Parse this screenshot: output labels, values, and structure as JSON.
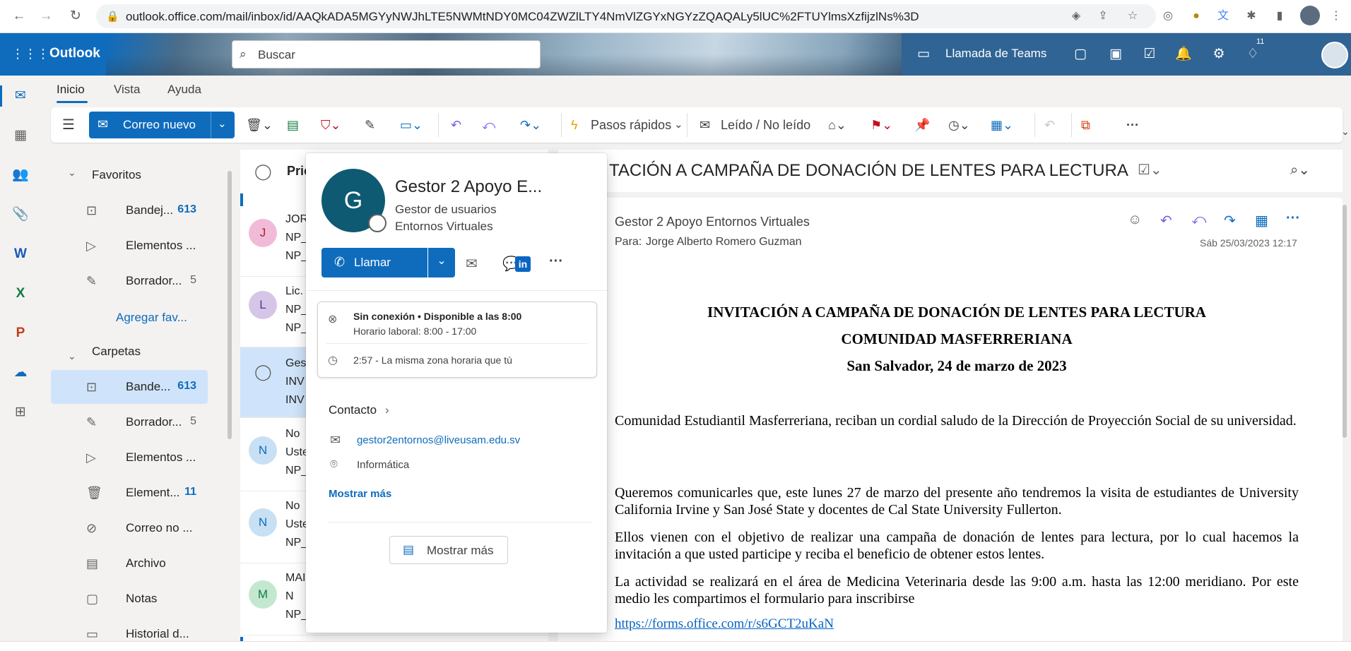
{
  "browser": {
    "url": "outlook.office.com/mail/inbox/id/AAQkADA5MGYyNWJhLTE5NWMtNDY0MC04ZWZlLTY4NmVlZGYxNGYzZQAQALy5lUC%2FTUYlmsXzfijzlNs%3D"
  },
  "header": {
    "app_name": "Outlook",
    "search_placeholder": "Buscar",
    "teams_call": "Llamada de Teams",
    "notifications_badge": "11"
  },
  "tabs": [
    "Inicio",
    "Vista",
    "Ayuda"
  ],
  "ribbon": {
    "new_mail": "Correo nuevo",
    "quick_steps": "Pasos rápidos",
    "read_unread": "Leído / No leído"
  },
  "folders": {
    "favorites_title": "Favoritos",
    "favorites": [
      {
        "label": "Bandej...",
        "count": "613"
      },
      {
        "label": "Elementos ...",
        "count": ""
      },
      {
        "label": "Borrador...",
        "count": "5"
      }
    ],
    "add_favorite": "Agregar fav...",
    "folders_title": "Carpetas",
    "items": [
      {
        "label": "Bande...",
        "count": "613"
      },
      {
        "label": "Borrador...",
        "count": "5"
      },
      {
        "label": "Elementos ...",
        "count": ""
      },
      {
        "label": "Element...",
        "count": "11"
      },
      {
        "label": "Correo no ...",
        "count": ""
      },
      {
        "label": "Archivo",
        "count": ""
      },
      {
        "label": "Notas",
        "count": ""
      },
      {
        "label": "Historial d...",
        "count": ""
      }
    ]
  },
  "message_list": {
    "tab_label": "Pric",
    "messages": [
      {
        "initial": "J",
        "lines": [
          "JOR",
          "NP_",
          "NP_"
        ]
      },
      {
        "initial": "L",
        "lines": [
          "Lic.",
          "NP_",
          "NP_"
        ]
      },
      {
        "initial": "",
        "lines": [
          "Ges",
          "INV",
          "INV"
        ]
      },
      {
        "initial": "N",
        "lines": [
          "No",
          "Uste",
          "NP_"
        ]
      },
      {
        "initial": "N",
        "lines": [
          "No",
          "Uste",
          "NP_"
        ]
      },
      {
        "initial": "M",
        "lines": [
          "MAI",
          "N",
          "NP_"
        ]
      }
    ]
  },
  "email": {
    "subject_visible": "TACIÓN A CAMPAÑA DE DONACIÓN DE LENTES PARA LECTURA",
    "sender": "Gestor 2 Apoyo Entornos Virtuales",
    "to_label": "Para:",
    "to_name": "Jorge Alberto Romero Guzman",
    "date": "Sáb 25/03/2023 12:17",
    "body_title_1": "INVITACIÓN A CAMPAÑA DE DONACIÓN DE LENTES PARA LECTURA",
    "body_title_2": "COMUNIDAD MASFERRERIANA",
    "body_title_3": "San Salvador, 24 de marzo de 2023",
    "p1": "Comunidad Estudiantil Masferreriana, reciban un cordial saludo de la Dirección de Proyección Social de su universidad.",
    "p2": "Queremos comunicarles que, este lunes 27 de marzo del presente año tendremos la visita de estudiantes de University California Irvine y San José State y docentes de Cal State University Fullerton.",
    "p3": "Ellos vienen con el objetivo de realizar una campaña de donación de lentes para lectura, por lo cual hacemos la invitación a que usted participe y reciba el beneficio de obtener estos lentes.",
    "p4": "La actividad se realizará en el área de Medicina Veterinaria desde las 9:00 a.m. hasta las 12:00 meridiano. Por este medio les compartimos el formulario para inscribirse",
    "link": "https://forms.office.com/r/s6GCT2uKaN"
  },
  "contact_card": {
    "initial": "G",
    "name": "Gestor 2 Apoyo E...",
    "title_line1": "Gestor de usuarios",
    "title_line2": "Entornos Virtuales",
    "call_button": "Llamar",
    "status": "Sin conexión • Disponible a las 8:00",
    "work_hours": "Horario laboral: 8:00 - 17:00",
    "time_zone": "2:57 - La misma zona horaria que tú",
    "contact_heading": "Contacto",
    "email": "gestor2entornos@liveusam.edu.sv",
    "location": "Informática",
    "show_more_link": "Mostrar más",
    "show_more_button": "Mostrar más"
  },
  "colors": {
    "accent": "#0f6cbd",
    "teams_band": "#2f6494"
  }
}
